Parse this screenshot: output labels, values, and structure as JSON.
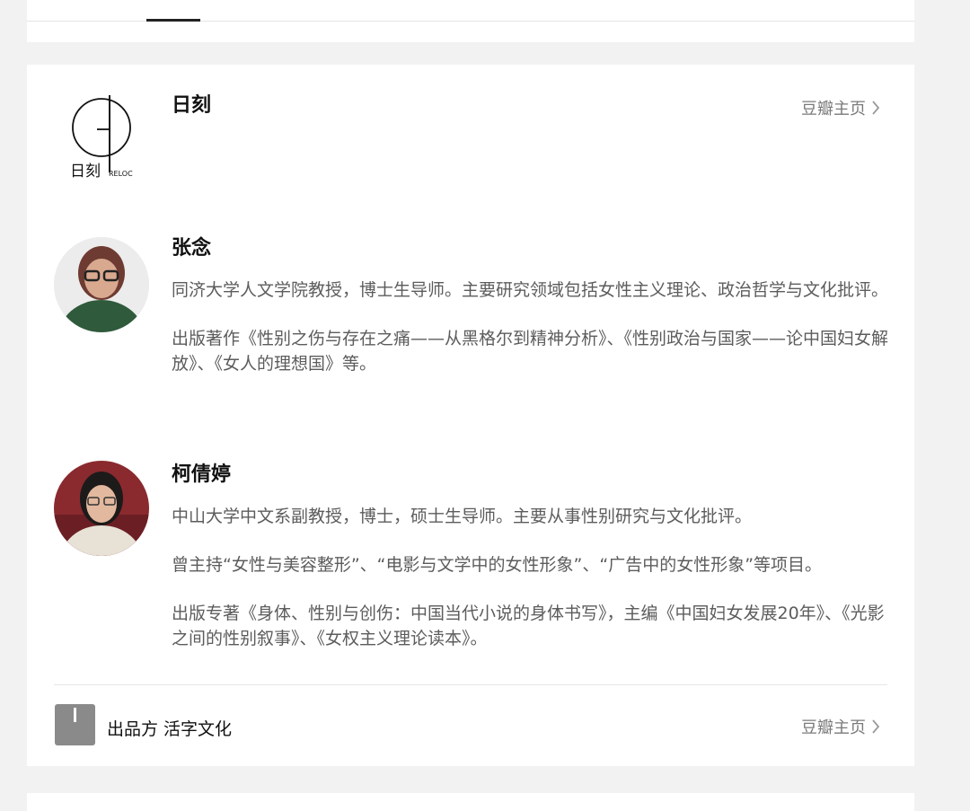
{
  "publisher": {
    "logo_text": "日刻",
    "logo_sub": "RELOC",
    "name": "日刻",
    "link": "豆瓣主页"
  },
  "authors": [
    {
      "name": "张念",
      "bio": [
        "同济大学人文学院教授，博士生导师。主要研究领域包括女性主义理论、政治哲学与文化批评。",
        "出版著作《性别之伤与存在之痛——从黑格尔到精神分析》、《性别政治与国家——论中国妇女解放》、《女人的理想国》等。"
      ]
    },
    {
      "name": "柯倩婷",
      "bio": [
        "中山大学中文系副教授，博士，硕士生导师。主要从事性别研究与文化批评。",
        "曾主持“女性与美容整形”、“电影与文学中的女性形象”、“广告中的女性形象”等项目。",
        "出版专著《身体、性别与创伤：中国当代小说的身体书写》，主编《中国妇女发展20年》、《光影之间的性别叙事》、《女权主义理论读本》。"
      ]
    }
  ],
  "producer": {
    "label": "出品方 活字文化",
    "link": "豆瓣主页"
  }
}
